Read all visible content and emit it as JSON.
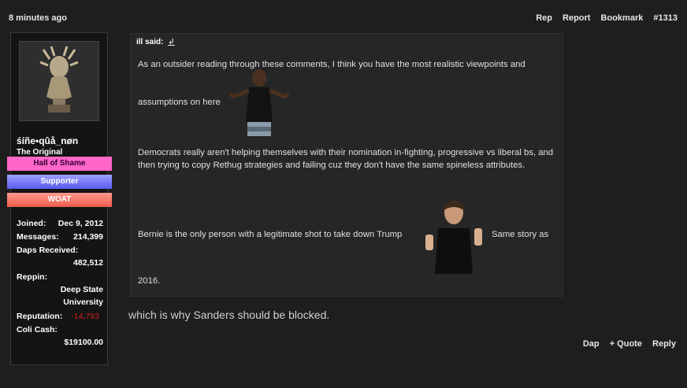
{
  "post": {
    "timestamp": "8 minutes ago",
    "actions": [
      "Rep",
      "Report",
      "Bookmark",
      "#1313"
    ],
    "reply_text": "which is why Sanders should be blocked.",
    "bottom_actions": [
      "Dap",
      "+ Quote",
      "Reply"
    ]
  },
  "user": {
    "name": "śíñe•qûå_nøn",
    "title": "The Original",
    "badges": [
      "Hall of Shame",
      "Supporter",
      "WOAT"
    ],
    "stats": {
      "joined_label": "Joined:",
      "joined": "Dec 9, 2012",
      "messages_label": "Messages:",
      "messages": "214,399",
      "daps_label": "Daps Received:",
      "daps": "482,512",
      "reppin_label": "Reppin:",
      "reppin_1": "Deep State",
      "reppin_2": "University",
      "reputation_label": "Reputation:",
      "reputation": "-14,793",
      "cash_label": "Coli Cash:",
      "cash": "$19100.00"
    }
  },
  "quote": {
    "author": "ill said:",
    "arrow": "↲",
    "line1": "As an outsider reading through these comments, I think you have the most realistic viewpoints and",
    "line2": "assumptions on here",
    "line3": "Democrats really aren't helping themselves with their nomination in-fighting, progressive vs liberal bs, and then trying to copy Rethug strategies and failing cuz they don't have the same spineless attributes.",
    "line4": "Bernie is the only person with a legitimate shot to take down Trump",
    "line5": "Same story as",
    "line6": "2016."
  }
}
